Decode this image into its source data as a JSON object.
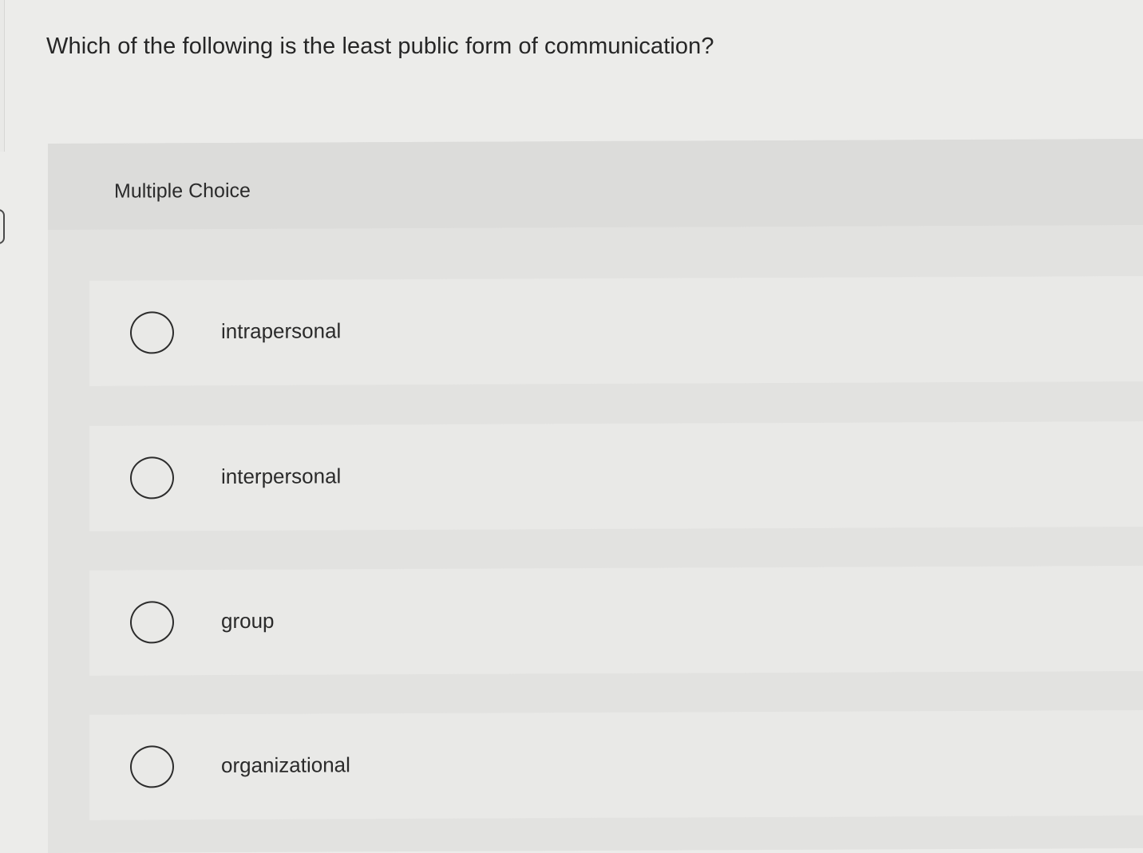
{
  "question": {
    "text": "Which of the following is the least public form of communication?"
  },
  "panel": {
    "label": "Multiple Choice"
  },
  "options": [
    {
      "label": "intrapersonal",
      "selected": false
    },
    {
      "label": "interpersonal",
      "selected": false
    },
    {
      "label": "group",
      "selected": false
    },
    {
      "label": "organizational",
      "selected": false
    }
  ]
}
